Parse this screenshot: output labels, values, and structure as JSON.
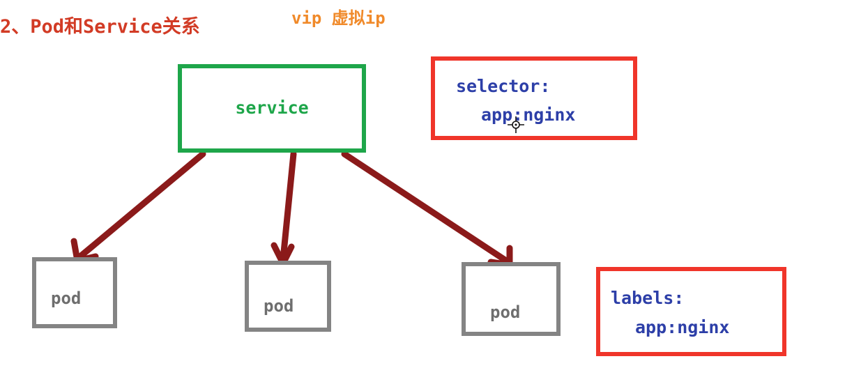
{
  "header": {
    "title": "2、Pod和Service关系",
    "vip_label": "vip 虚拟ip"
  },
  "service": {
    "label": "service"
  },
  "selector": {
    "key": "selector:",
    "value": "app:nginx"
  },
  "pods": [
    {
      "label": "pod"
    },
    {
      "label": "pod"
    },
    {
      "label": "pod"
    }
  ],
  "labels": {
    "key": "labels:",
    "value": "app:nginx"
  },
  "colors": {
    "title": "#d23b25",
    "vip": "#f08a2a",
    "service_border": "#1ea64a",
    "highlight_border": "#f0352a",
    "pod_border": "#848484",
    "arrow": "#8b1a1a",
    "kv_text": "#2d3fa8"
  },
  "icons": {
    "cursor": "crosshair-cursor-icon"
  }
}
